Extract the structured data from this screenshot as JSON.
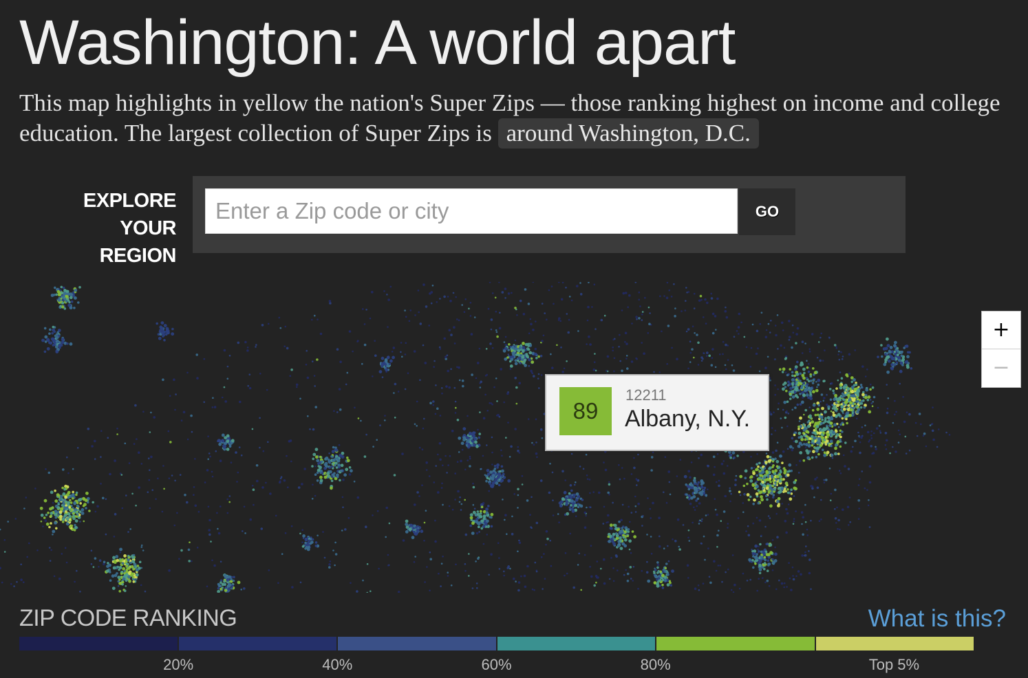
{
  "header": {
    "title": "Washington: A world apart",
    "intro_text": "This map highlights in yellow the nation's Super Zips — those ranking highest on income and college education. The largest collection of Super Zips is",
    "intro_link": "around Washington, D.C."
  },
  "search": {
    "label": "EXPLORE YOUR REGION",
    "placeholder": "Enter a Zip code or city",
    "value": "",
    "go_label": "GO"
  },
  "map": {
    "zoom_in_label": "+",
    "zoom_out_label": "−",
    "colors": {
      "background": "#232323",
      "low": "#1a1e4c",
      "mid": "#3a6b8e",
      "high": "#86bb37",
      "top": "#d4dc5a"
    }
  },
  "tooltip": {
    "rank": "89",
    "zip": "12211",
    "city": "Albany, N.Y.",
    "rank_color": "#86bb37"
  },
  "legend": {
    "title": "ZIP CODE RANKING",
    "link": "What is this?",
    "colors": [
      "#1c1f4d",
      "#25306a",
      "#3a5087",
      "#3a9190",
      "#86bb37",
      "#cbcf65"
    ],
    "ticks": [
      "20%",
      "40%",
      "60%",
      "80%",
      "Top 5%"
    ]
  }
}
